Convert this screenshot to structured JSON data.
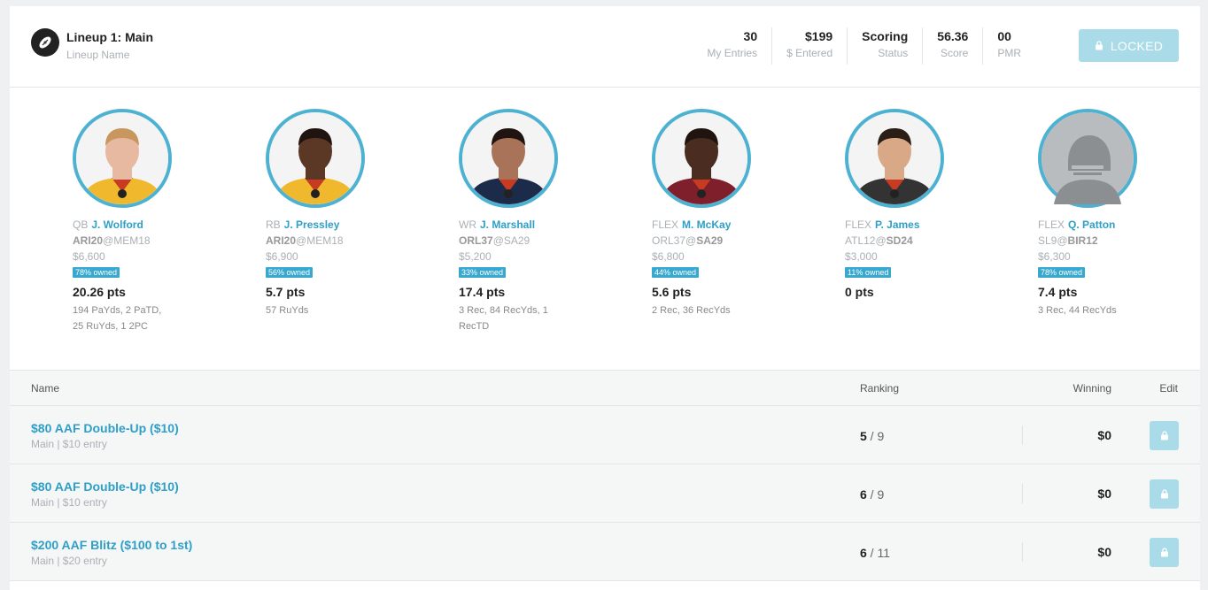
{
  "lineup": {
    "title": "Lineup 1: Main",
    "subtitle": "Lineup Name"
  },
  "stats": [
    {
      "value": "30",
      "label": "My Entries"
    },
    {
      "value": "$199",
      "label": "$ Entered"
    },
    {
      "value": "Scoring",
      "label": "Status"
    },
    {
      "value": "56.36",
      "label": "Score"
    },
    {
      "value": "00",
      "label": "PMR"
    }
  ],
  "locked_label": "LOCKED",
  "players": [
    {
      "pos": "QB",
      "name": "J. Wolford",
      "team": "ARI20",
      "at": "@MEM18",
      "team_bold": true,
      "opp_bold": false,
      "salary": "$6,600",
      "owned": "78% owned",
      "pts": "20.26 pts",
      "stats": "194 PaYds, 2 PaTD, 25 RuYds, 1 2PC",
      "jersey": "#f0b92d",
      "skin": "#e7b9a1",
      "hair": "#c8965f"
    },
    {
      "pos": "RB",
      "name": "J. Pressley",
      "team": "ARI20",
      "at": "@MEM18",
      "team_bold": true,
      "opp_bold": false,
      "salary": "$6,900",
      "owned": "56% owned",
      "pts": "5.7 pts",
      "stats": "57 RuYds",
      "jersey": "#f0b92d",
      "skin": "#5b3826",
      "hair": "#1f1410"
    },
    {
      "pos": "WR",
      "name": "J. Marshall",
      "team": "ORL37",
      "at": "@SA29",
      "team_bold": true,
      "opp_bold": false,
      "salary": "$5,200",
      "owned": "33% owned",
      "pts": "17.4 pts",
      "stats": "3 Rec, 84 RecYds, 1 RecTD",
      "jersey": "#1d2b4a",
      "skin": "#a87358",
      "hair": "#1f1410"
    },
    {
      "pos": "FLEX",
      "name": "M. McKay",
      "team": "ORL37",
      "at": "@SA29",
      "team_bold": false,
      "opp_bold": true,
      "salary": "$6,800",
      "owned": "44% owned",
      "pts": "5.6 pts",
      "stats": "2 Rec, 36 RecYds",
      "jersey": "#7e1f2b",
      "skin": "#4a2c20",
      "hair": "#1f1410"
    },
    {
      "pos": "FLEX",
      "name": "P. James",
      "team": "ATL12",
      "at": "@SD24",
      "team_bold": false,
      "opp_bold": true,
      "salary": "$3,000",
      "owned": "11% owned",
      "pts": "0 pts",
      "stats": "",
      "jersey": "#333333",
      "skin": "#d9a987",
      "hair": "#2a1e17"
    },
    {
      "pos": "FLEX",
      "name": "Q. Patton",
      "team": "SL9",
      "at": "@BIR12",
      "team_bold": false,
      "opp_bold": true,
      "salary": "$6,300",
      "owned": "78% owned",
      "pts": "7.4 pts",
      "stats": "3 Rec, 44 RecYds",
      "jersey": "",
      "skin": "",
      "hair": ""
    }
  ],
  "table": {
    "headers": {
      "name": "Name",
      "ranking": "Ranking",
      "winning": "Winning",
      "edit": "Edit"
    },
    "rows": [
      {
        "name": "$80 AAF Double-Up ($10)",
        "sub": "Main | $10 entry",
        "rank": "5",
        "total": "9",
        "winning": "$0"
      },
      {
        "name": "$80 AAF Double-Up ($10)",
        "sub": "Main | $10 entry",
        "rank": "6",
        "total": "9",
        "winning": "$0"
      },
      {
        "name": "$200 AAF Blitz ($100 to 1st)",
        "sub": "Main | $20 entry",
        "rank": "6",
        "total": "11",
        "winning": "$0"
      }
    ]
  },
  "colors": {
    "accent": "#2e9fc7",
    "ring": "#4db2d2",
    "locked": "#a9dbe8"
  }
}
